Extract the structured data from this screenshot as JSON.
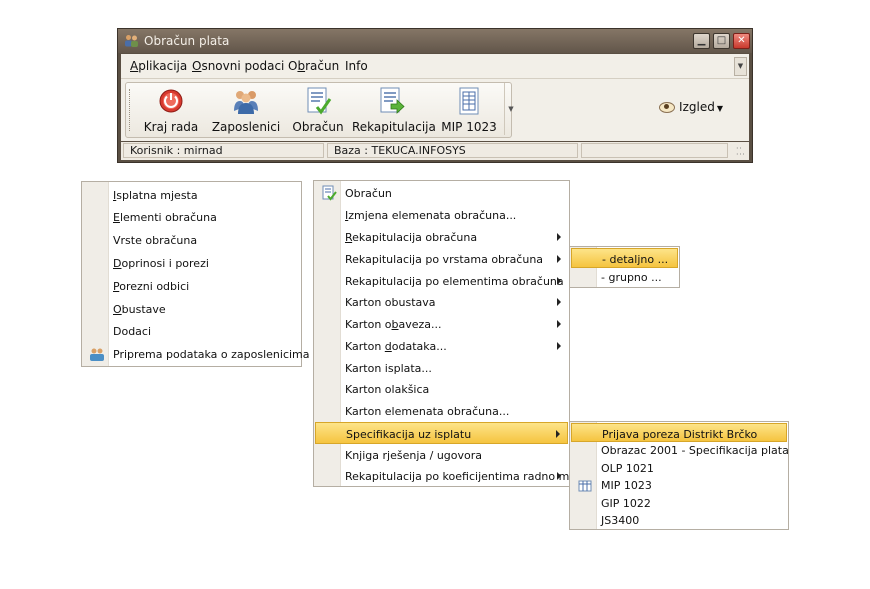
{
  "window": {
    "title": "Obračun plata",
    "menu": [
      {
        "pre": "",
        "u": "A",
        "post": "plikacija"
      },
      {
        "pre": "",
        "u": "O",
        "post": "snovni podaci"
      },
      {
        "pre": "O",
        "u": "b",
        "post": "račun"
      },
      {
        "pre": "",
        "u": "",
        "post": "Info"
      }
    ],
    "toolbar": [
      {
        "label": "Kraj rada",
        "icon": "power-icon"
      },
      {
        "label": "Zaposlenici",
        "icon": "users-icon"
      },
      {
        "label": "Obračun",
        "icon": "document-check-icon"
      },
      {
        "label": "Rekapitulacija",
        "icon": "document-arrow-icon"
      },
      {
        "label": "MIP 1023",
        "icon": "document-table-icon"
      }
    ],
    "izgled": "Izgled",
    "status": {
      "user": "Korisnik :  mirnad",
      "db": "Baza :  TEKUCA.INFOSYS"
    }
  },
  "menu_left": {
    "items": [
      {
        "u": "I",
        "post": "splatna mjesta"
      },
      {
        "u": "E",
        "post": "lementi obračuna"
      },
      {
        "u": "",
        "post": "Vrste obračuna"
      },
      {
        "u": "D",
        "post": "oprinosi i porezi"
      },
      {
        "u": "P",
        "post": "orezni odbici"
      },
      {
        "u": "O",
        "post": "bustave"
      },
      {
        "u": "",
        "post": "Dodaci"
      },
      {
        "u": "",
        "post": "Priprema podataka o zaposlenicima"
      }
    ]
  },
  "menu_obracun": {
    "items": [
      {
        "pre": "",
        "u": "",
        "post": "Obračun"
      },
      {
        "pre": "",
        "u": "I",
        "post": "zmjena elemenata obračuna..."
      },
      {
        "pre": "",
        "u": "R",
        "post": "ekapitulacija obračuna"
      },
      {
        "pre": "",
        "u": "",
        "post": "Rekapitulacija po vrstama obračuna"
      },
      {
        "pre": "",
        "u": "",
        "post": "Rekapitulacija po elementima obračuna"
      },
      {
        "pre": "",
        "u": "",
        "post": "Karton obustava"
      },
      {
        "pre": "Karton o",
        "u": "b",
        "post": "aveza..."
      },
      {
        "pre": "Karton ",
        "u": "d",
        "post": "odataka..."
      },
      {
        "pre": "",
        "u": "",
        "post": "Karton isplata..."
      },
      {
        "pre": "",
        "u": "",
        "post": "Karton olakšica"
      },
      {
        "pre": "",
        "u": "",
        "post": "Karton elemenata obračuna..."
      },
      {
        "pre": "",
        "u": "",
        "post": "Specifikacija uz isplatu"
      },
      {
        "pre": "",
        "u": "",
        "post": "Knjiga rješenja / ugovora"
      },
      {
        "pre": "",
        "u": "",
        "post": "Rekapitulacija po koeficijentima radno mjesta"
      }
    ]
  },
  "submenu_detalj": {
    "items": [
      "- detaljno ...",
      "- grupno ..."
    ]
  },
  "submenu_spec": {
    "items": [
      "Prijava poreza Distrikt Brčko",
      "Obrazac 2001 - Specifikacija plata",
      "OLP 1021",
      "MIP 1023",
      "GIP 1022",
      "JS3400"
    ]
  },
  "colors": {
    "title_bar": "#6d6053",
    "menu_highlight": "#f5c440",
    "close_button": "#c93a2e"
  }
}
